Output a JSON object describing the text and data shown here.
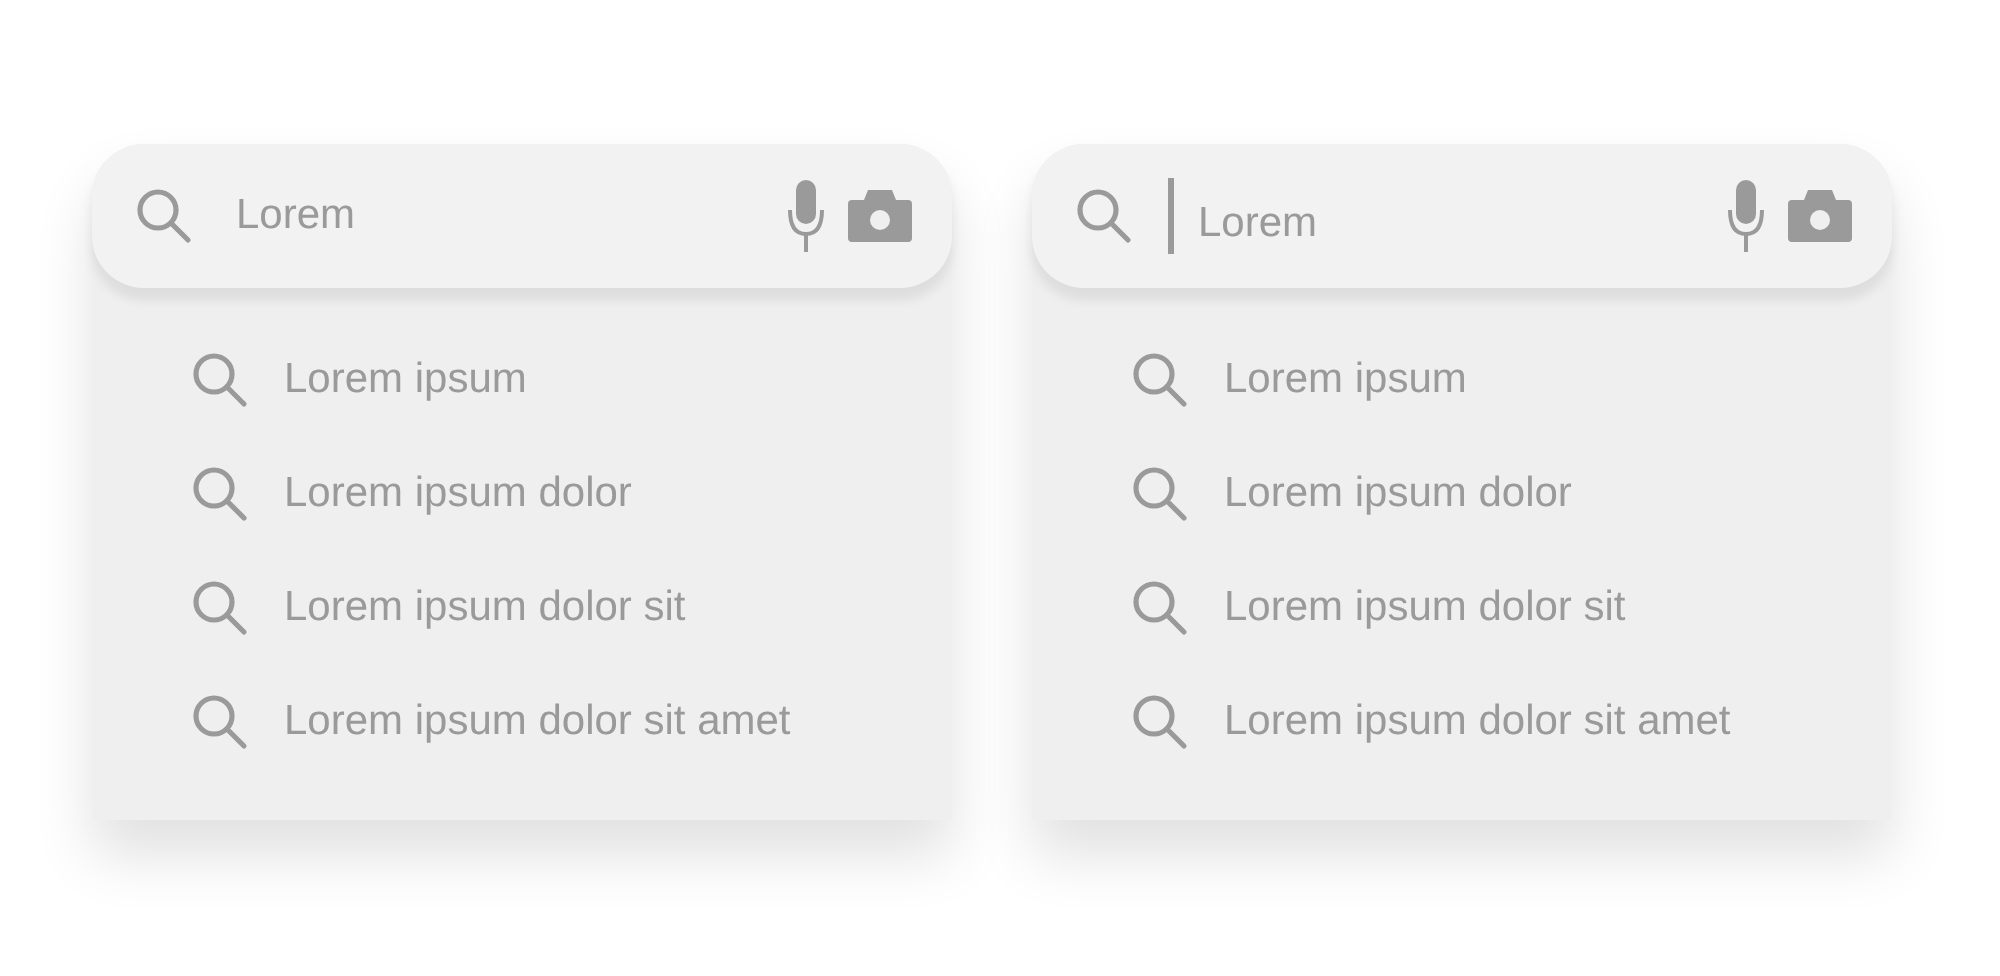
{
  "search_panels": [
    {
      "query": "Lorem",
      "cursor": false,
      "suggestions": [
        "Lorem ipsum",
        "Lorem ipsum dolor",
        "Lorem ipsum dolor sit",
        "Lorem ipsum dolor sit amet"
      ]
    },
    {
      "query": "Lorem",
      "cursor": true,
      "suggestions": [
        "Lorem ipsum",
        "Lorem ipsum dolor",
        "Lorem ipsum dolor sit",
        "Lorem ipsum dolor sit amet"
      ]
    }
  ]
}
